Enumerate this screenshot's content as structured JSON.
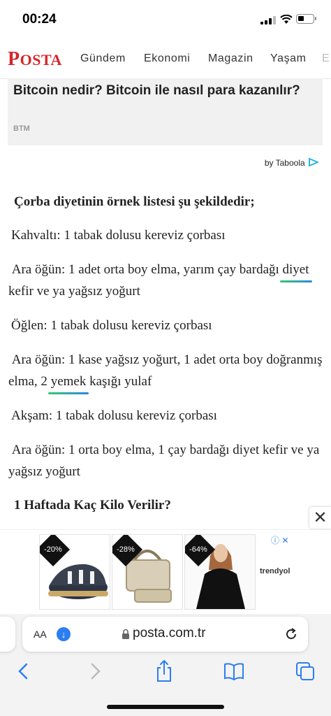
{
  "status": {
    "time": "00:24"
  },
  "nav": {
    "logo_first": "P",
    "logo_rest": "OSTA",
    "links": [
      "Gündem",
      "Ekonomi",
      "Magazin",
      "Yaşam",
      "E"
    ]
  },
  "promo": {
    "title": "Bitcoin nedir? Bitcoin ile nasıl para kazanılır?",
    "source": "BTM",
    "by": "by Taboola"
  },
  "article": {
    "heading": "Çorba diyetinin örnek listesi şu şekildedir;",
    "p1": "Kahvaltı: 1 tabak dolusu kereviz çorbası",
    "p2_a": "Ara öğün: 1 adet orta boy elma, yarım çay bardağı",
    "p2_kw": "diyet",
    "p2_b": " kefir ve ya yağsız yoğurt",
    "p3": "Öğlen: 1 tabak dolusu kereviz çorbası",
    "p4_a": "Ara öğün: 1 kase yağsız yoğurt, 1 adet orta boy doğranmış elma, 2 ",
    "p4_kw": "yemek",
    "p4_b": " kaşığı yulaf",
    "p5": "Akşam: 1 tabak dolusu kereviz çorbası",
    "p6": "Ara öğün: 1 orta boy elma, 1 çay bardağı diyet kefir ve ya yağsız yoğurt",
    "subheading": "1 Haftada Kaç Kilo Verilir?"
  },
  "ad": {
    "discounts": [
      "-20%",
      "-28%",
      "-64%"
    ],
    "brand": "trendyol",
    "close_symbol": "✕"
  },
  "browser": {
    "text_size": "AA",
    "url": "posta.com.tr"
  },
  "colors": {
    "brand_red": "#d6262b",
    "link_blue": "#2c7ef0",
    "keyword_underline_start": "#32c96b",
    "keyword_underline_end": "#2f86e0"
  },
  "icons": [
    "signal-icon",
    "wifi-icon",
    "battery-icon",
    "download-icon",
    "lock-icon",
    "reload-icon",
    "back-icon",
    "forward-icon",
    "share-icon",
    "bookmarks-icon",
    "tabs-icon",
    "adchoices-icon",
    "close-icon"
  ]
}
